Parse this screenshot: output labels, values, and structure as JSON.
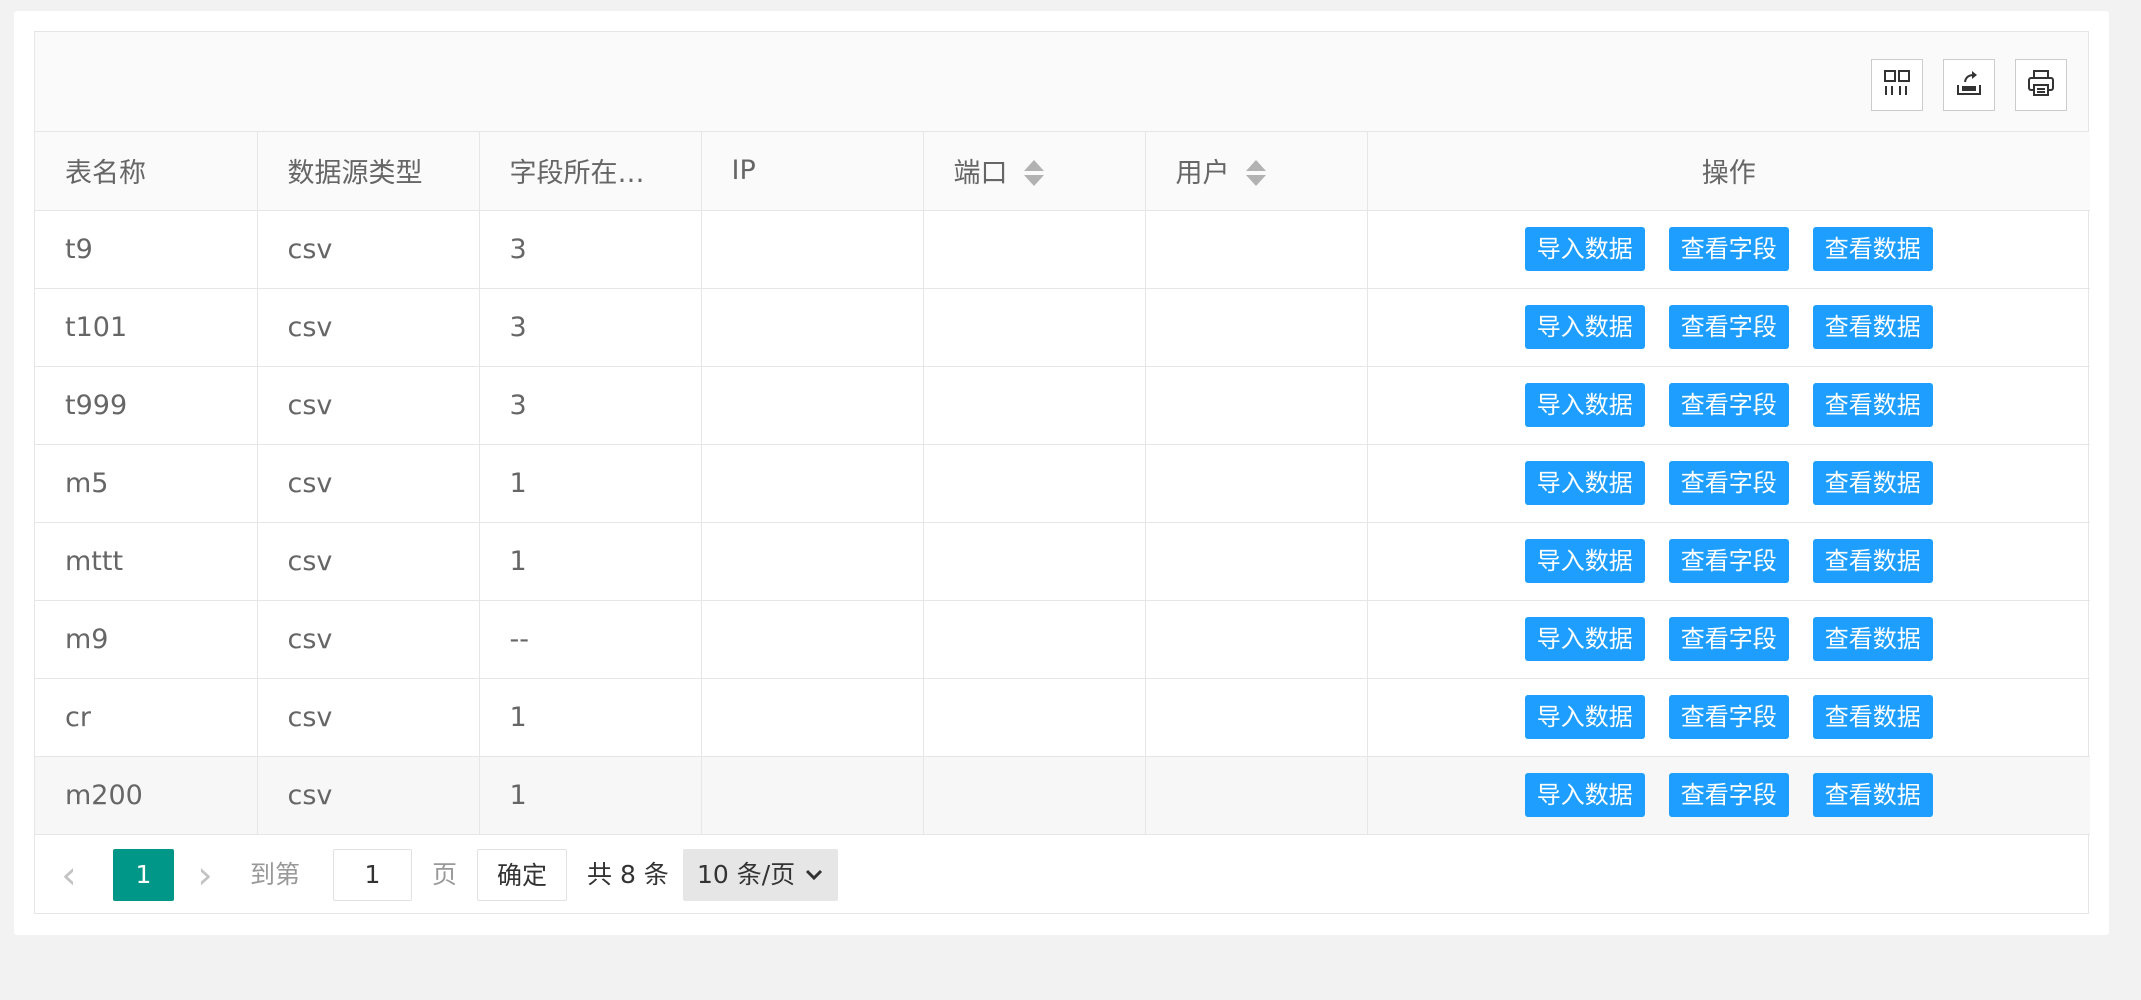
{
  "toolbar": {
    "icons": [
      "columns-icon",
      "export-icon",
      "print-icon"
    ]
  },
  "table": {
    "headers": {
      "name": "表名称",
      "source_type": "数据源类型",
      "field_location": "字段所在…",
      "ip": "IP",
      "port": "端口",
      "user": "用户",
      "ops": "操作"
    },
    "action_labels": {
      "import": "导入数据",
      "view_fields": "查看字段",
      "view_data": "查看数据"
    },
    "rows": [
      {
        "name": "t9",
        "source_type": "csv",
        "field_location": "3",
        "ip": "",
        "port": "",
        "user": ""
      },
      {
        "name": "t101",
        "source_type": "csv",
        "field_location": "3",
        "ip": "",
        "port": "",
        "user": ""
      },
      {
        "name": "t999",
        "source_type": "csv",
        "field_location": "3",
        "ip": "",
        "port": "",
        "user": ""
      },
      {
        "name": "m5",
        "source_type": "csv",
        "field_location": "1",
        "ip": "",
        "port": "",
        "user": ""
      },
      {
        "name": "mttt",
        "source_type": "csv",
        "field_location": "1",
        "ip": "",
        "port": "",
        "user": ""
      },
      {
        "name": "m9",
        "source_type": "csv",
        "field_location": "--",
        "ip": "",
        "port": "",
        "user": ""
      },
      {
        "name": "cr",
        "source_type": "csv",
        "field_location": "1",
        "ip": "",
        "port": "",
        "user": ""
      },
      {
        "name": "m200",
        "source_type": "csv",
        "field_location": "1",
        "ip": "",
        "port": "",
        "user": ""
      }
    ]
  },
  "pagination": {
    "prev": "‹",
    "next": "›",
    "current_page": "1",
    "goto_label": "到第",
    "goto_value": "1",
    "page_unit": "页",
    "confirm": "确定",
    "total": "共 8 条",
    "page_size": "10 条/页"
  },
  "colors": {
    "action_button": "#1e9fff",
    "current_page": "#009688"
  }
}
